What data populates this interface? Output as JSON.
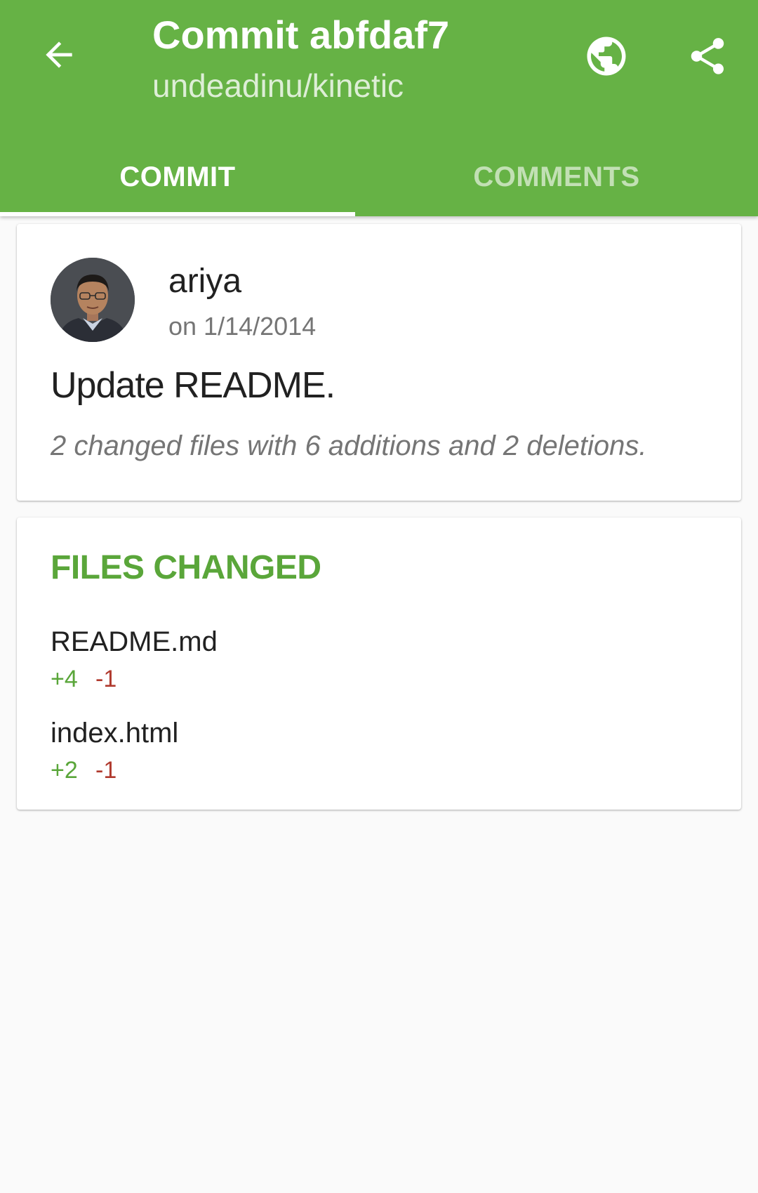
{
  "appbar": {
    "title": "Commit abfdaf7",
    "subtitle": "undeadinu/kinetic",
    "color": "#66b245",
    "back_icon": "arrow-back-icon",
    "actions": [
      "globe-icon",
      "share-icon"
    ]
  },
  "tabs": [
    {
      "label": "COMMIT",
      "selected": true
    },
    {
      "label": "COMMENTS",
      "selected": false
    }
  ],
  "commit": {
    "author": "ariya",
    "date": "on 1/14/2014",
    "message": "Update README.",
    "stats": "2 changed files with 6 additions and 2 deletions."
  },
  "files": {
    "heading": "FILES CHANGED",
    "items": [
      {
        "name": "README.md",
        "additions": "+4",
        "deletions": "-1"
      },
      {
        "name": "index.html",
        "additions": "+2",
        "deletions": "-1"
      }
    ]
  },
  "colors": {
    "accent": "#66b245",
    "addition": "#5aa63a",
    "deletion": "#b03a2e"
  }
}
